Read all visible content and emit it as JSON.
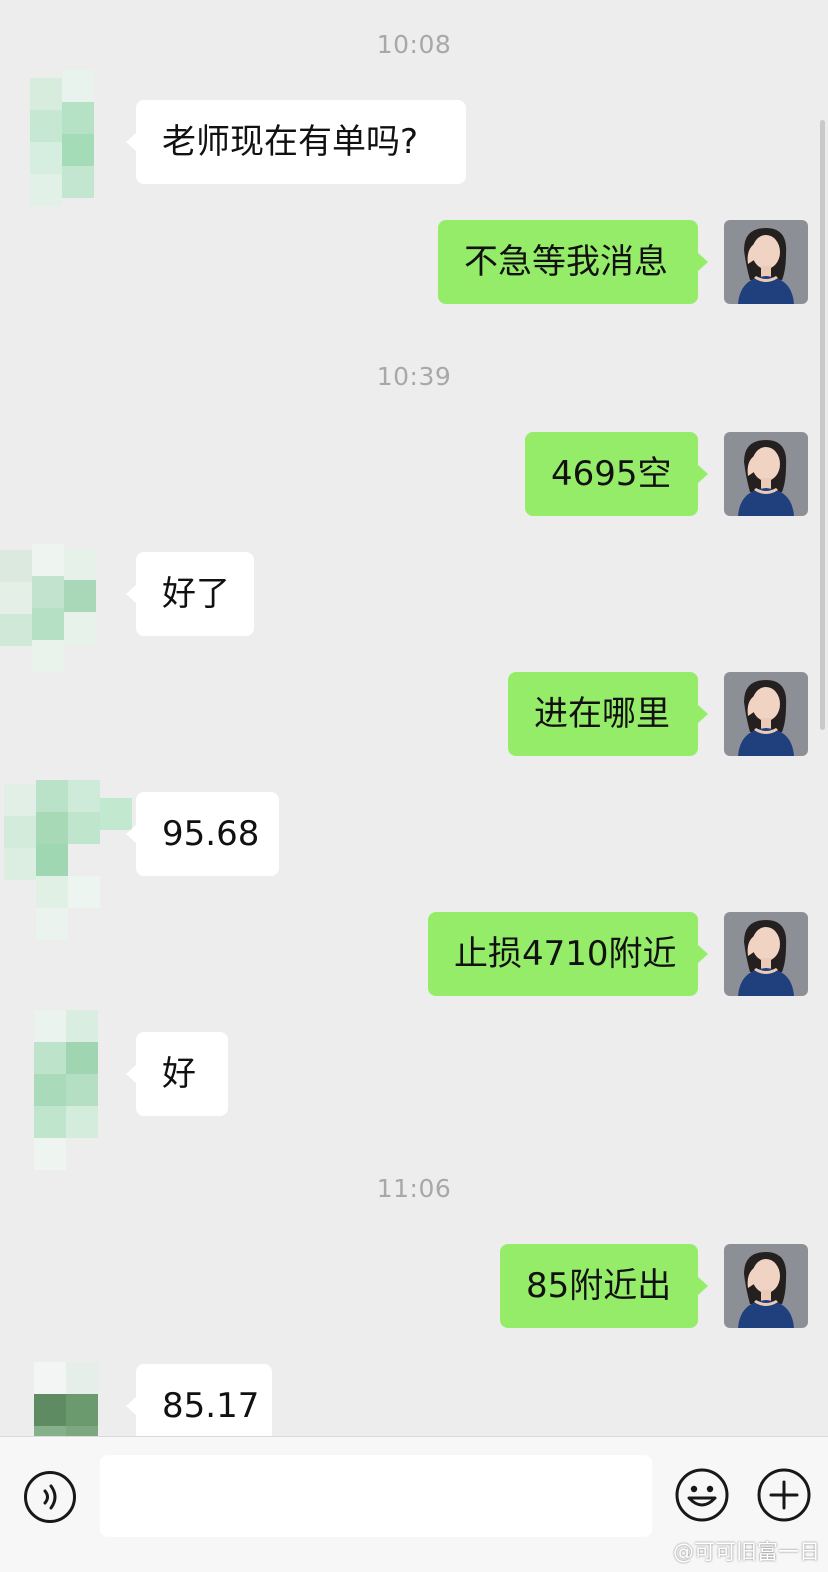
{
  "chat": {
    "timestamps": [
      "10:08",
      "10:39",
      "11:06"
    ],
    "messages": [
      {
        "side": "in",
        "text": "老师现在有单吗?"
      },
      {
        "side": "out",
        "text": "不急等我消息"
      },
      {
        "side": "out",
        "text": "4695空"
      },
      {
        "side": "in",
        "text": "好了"
      },
      {
        "side": "out",
        "text": "进在哪里"
      },
      {
        "side": "in",
        "text": "95.68"
      },
      {
        "side": "out",
        "text": "止损4710附近"
      },
      {
        "side": "in",
        "text": "好"
      },
      {
        "side": "out",
        "text": "85附近出"
      },
      {
        "side": "in",
        "text": "85.17"
      }
    ]
  },
  "input_bar": {
    "input_value": "",
    "icons": [
      "voice-icon",
      "emoji-icon",
      "plus-icon"
    ]
  },
  "colors": {
    "background": "#ededed",
    "incoming_bubble": "#ffffff",
    "outgoing_bubble": "#95ec69",
    "timestamp_text": "#a8a8a8"
  },
  "watermark": "@可可旧富一日"
}
